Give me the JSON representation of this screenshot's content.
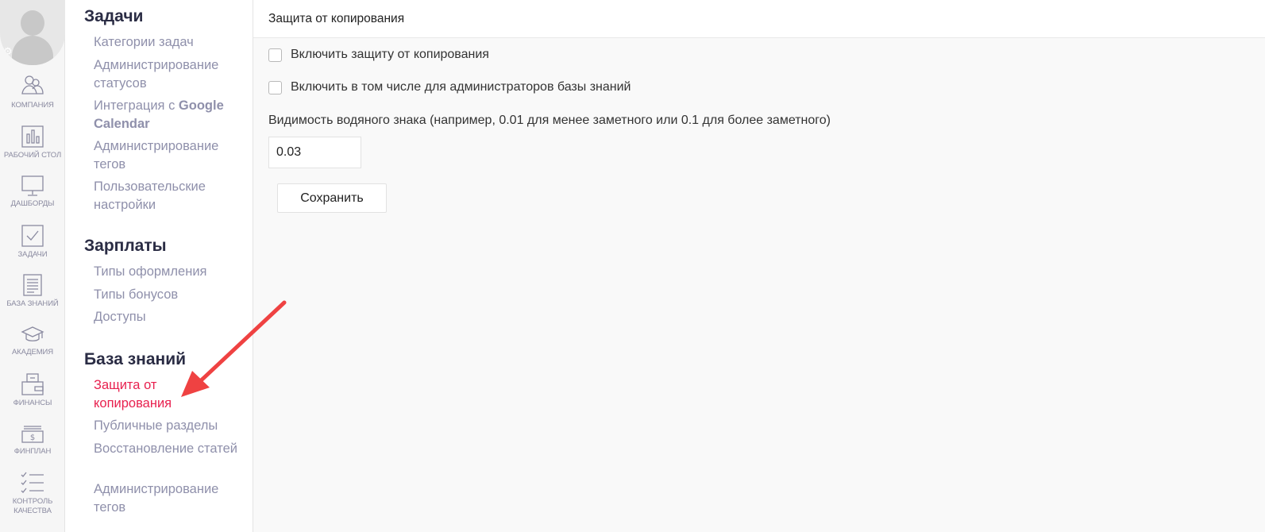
{
  "rail": {
    "items": [
      {
        "label": "КОМПАНИЯ",
        "icon": "company-icon"
      },
      {
        "label": "РАБОЧИЙ СТОЛ",
        "icon": "bar-chart-icon"
      },
      {
        "label": "ДАШБОРДЫ",
        "icon": "monitor-icon"
      },
      {
        "label": "ЗАДАЧИ",
        "icon": "checkbox-icon"
      },
      {
        "label": "БАЗА ЗНАНИЙ",
        "icon": "document-icon"
      },
      {
        "label": "АКАДЕМИЯ",
        "icon": "graduation-cap-icon"
      },
      {
        "label": "ФИНАНСЫ",
        "icon": "wallet-icon"
      },
      {
        "label": "ФИНПЛАН",
        "icon": "banknote-icon"
      },
      {
        "label": "КОНТРОЛЬ КАЧЕСТВА",
        "icon": "checklist-icon"
      }
    ]
  },
  "nav": {
    "sections": [
      {
        "title": "Задачи",
        "links": [
          "Категории задач",
          "Администрирование статусов",
          "Интеграция с",
          "Администрирование тегов",
          "Пользовательские настройки"
        ],
        "link_bold": "Google Calendar"
      },
      {
        "title": "Зарплаты",
        "links": [
          "Типы оформления",
          "Типы бонусов",
          "Доступы"
        ]
      },
      {
        "title": "База знаний",
        "links": [
          "Защита от копирования",
          "Публичные разделы",
          "Восстановление статей",
          "Администрирование тегов"
        ]
      }
    ],
    "active_color": "#e8214f",
    "link_color": "#8f90ab"
  },
  "main": {
    "title": "Защита от копирования",
    "checkbox_1": {
      "label": "Включить защиту от копирования",
      "checked": false
    },
    "checkbox_2": {
      "label": "Включить в том числе для администраторов базы знаний",
      "checked": false
    },
    "watermark_label": "Видимость водяного знака (например, 0.01 для менее заметного или 0.1 для более заметного)",
    "watermark_value": "0.03",
    "save_label": "Сохранить"
  }
}
